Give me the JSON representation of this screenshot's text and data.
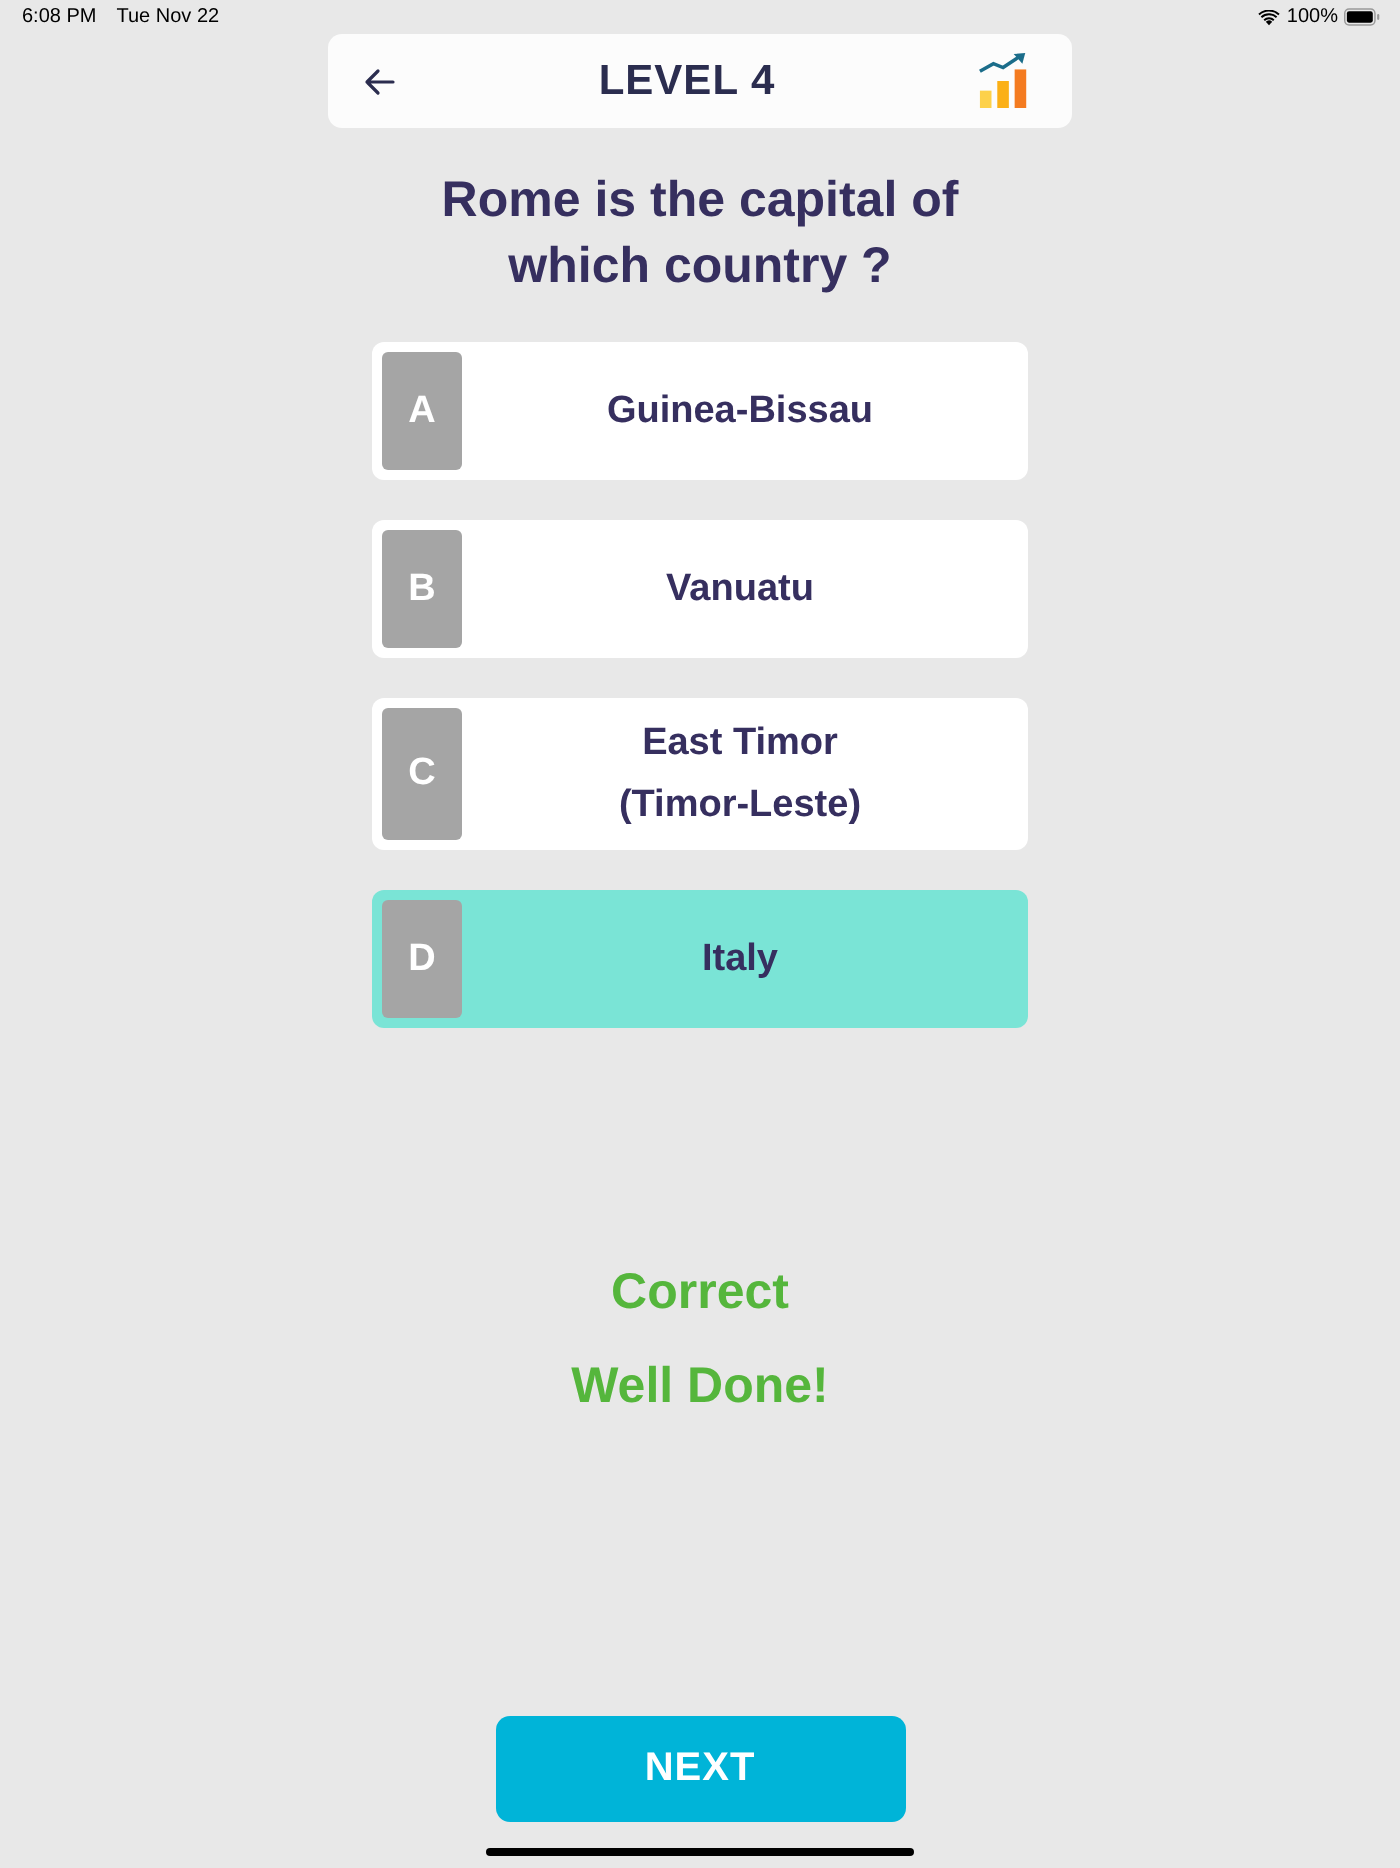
{
  "status_bar": {
    "time": "6:08 PM",
    "date": "Tue Nov 22",
    "battery": "100%"
  },
  "header": {
    "title": "LEVEL 4"
  },
  "question": "Rome is the capital of which country ?",
  "options": [
    {
      "letter": "A",
      "text": "Guinea-Bissau",
      "selected": false
    },
    {
      "letter": "B",
      "text": "Vanuatu",
      "selected": false
    },
    {
      "letter": "C",
      "text": "East Timor (Timor-Leste)",
      "selected": false
    },
    {
      "letter": "D",
      "text": "Italy",
      "selected": true
    }
  ],
  "feedback": {
    "result": "Correct",
    "message": "Well Done!"
  },
  "next_button": {
    "label": "NEXT"
  }
}
